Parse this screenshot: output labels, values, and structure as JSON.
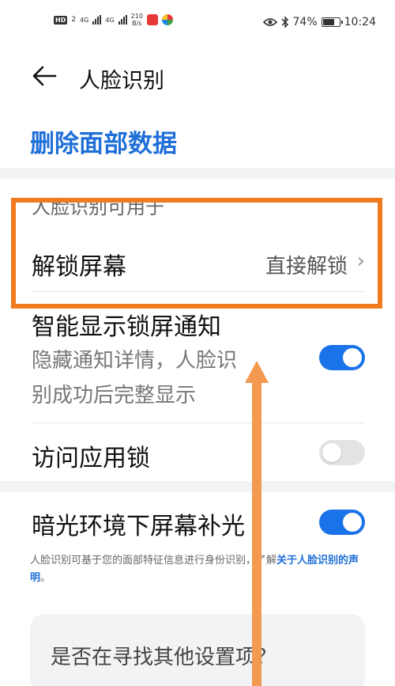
{
  "status_bar": {
    "hd": "HD",
    "sim": "2",
    "net1": "4G",
    "net2": "4G",
    "speed_value": "210",
    "speed_unit": "B/s",
    "battery": "74%",
    "time": "10:24"
  },
  "header": {
    "title": "人脸识别"
  },
  "delete_link": "删除面部数据",
  "section_header": "人脸识别可用于",
  "rows": {
    "unlock": {
      "label": "解锁屏幕",
      "value": "直接解锁"
    },
    "smart_notify": {
      "label": "智能显示锁屏通知",
      "sub_line1": "隐藏通知详情，人脸识",
      "sub_line2": "别成功后完整显示",
      "enabled": true
    },
    "app_lock": {
      "label": "访问应用锁",
      "enabled": false
    },
    "fill_light": {
      "label": "暗光环境下屏幕补光",
      "enabled": true
    }
  },
  "footnote": {
    "text": "人脸识别可基于您的面部特征信息进行身份识别，了解",
    "link": "关于人脸识别的声明",
    "end": "。"
  },
  "search_card": {
    "title": "是否在寻找其他设置项？"
  },
  "colors": {
    "accent": "#1f6fd8",
    "toggle_on": "#1a73e8",
    "annotation": "#f07a1e"
  }
}
